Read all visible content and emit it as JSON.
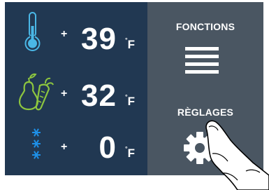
{
  "readings": [
    {
      "icon": "thermometer-icon",
      "sign": "+",
      "value": "39",
      "unit": "F",
      "degree_symbol": "°"
    },
    {
      "icon": "fruit-vegetable-icon",
      "sign": "+",
      "value": "32",
      "unit": "F",
      "degree_symbol": "°"
    },
    {
      "icon": "snowflake-icon",
      "sign": "+",
      "value": "0",
      "unit": "F",
      "degree_symbol": "°"
    }
  ],
  "menu": {
    "functions_label": "FONCTIONS",
    "functions_icon": "hamburger-menu-icon",
    "settings_label": "RÈGLAGES",
    "settings_icon": "gear-icon"
  },
  "colors": {
    "screen_background": "#213852",
    "panel_background": "#4a5662",
    "fridge_accent": "#4ab7e6",
    "fresh_accent": "#8dc63f",
    "freezer_accent": "#1e90e8",
    "text": "#ffffff"
  }
}
